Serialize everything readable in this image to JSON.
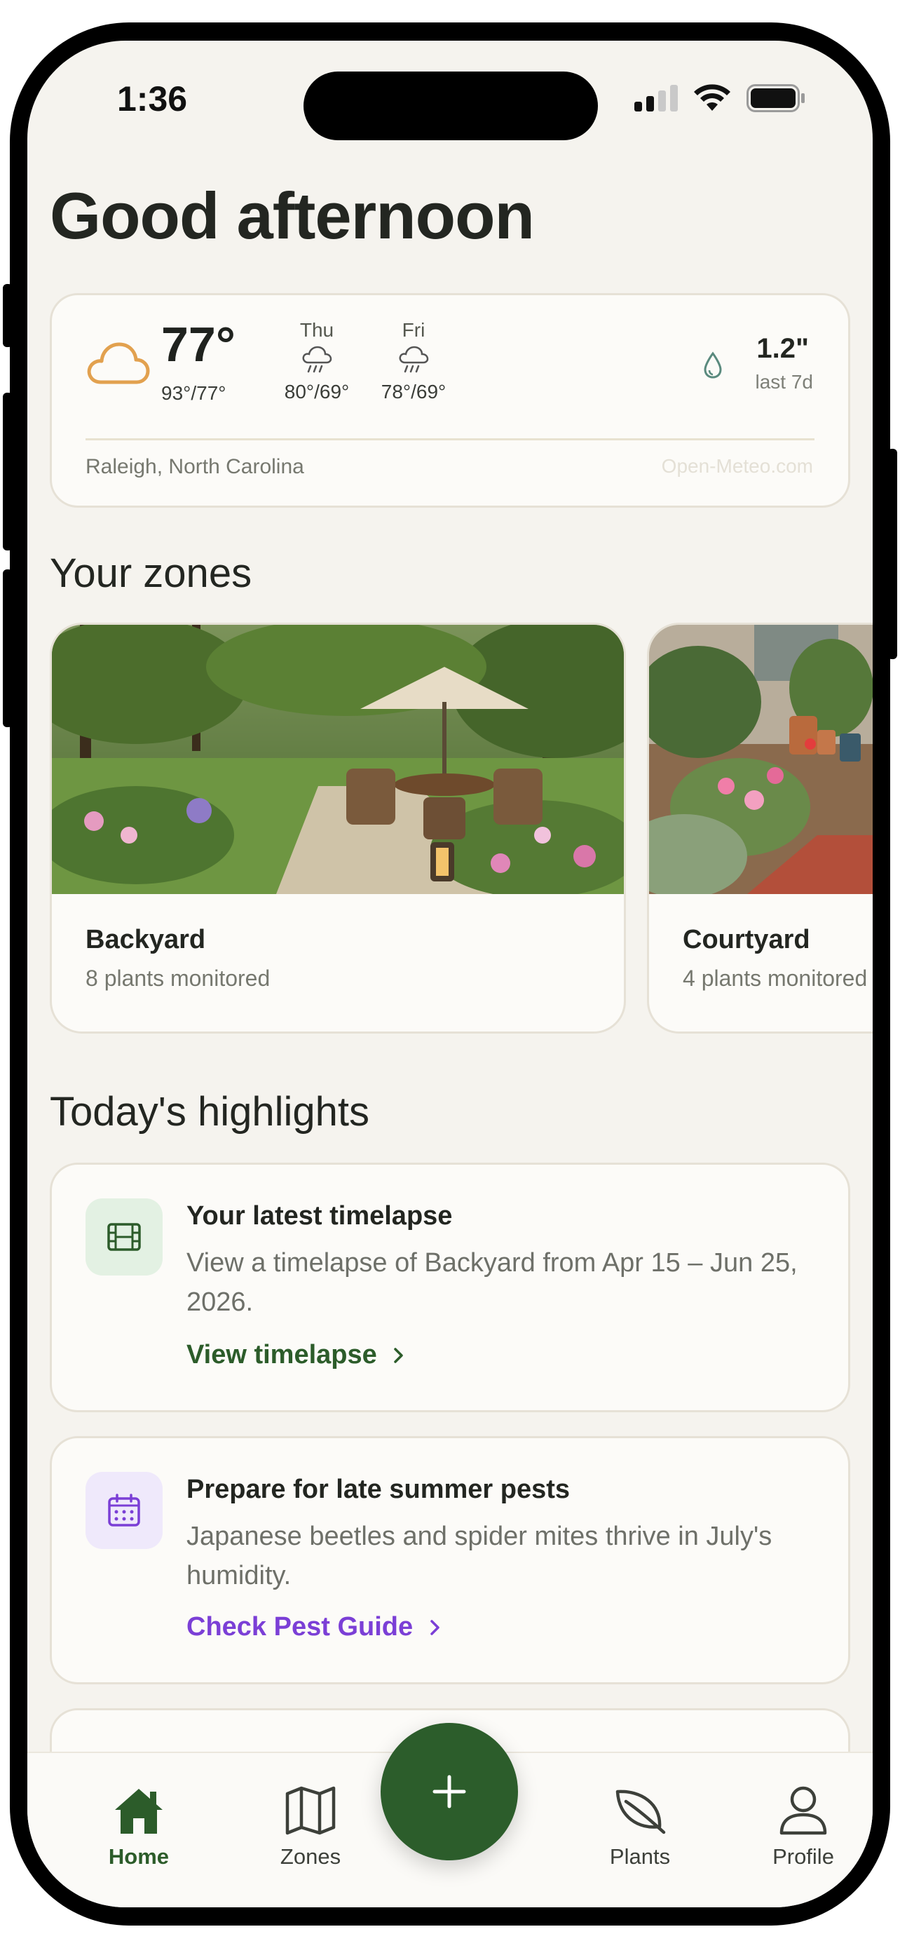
{
  "status_bar": {
    "time": "1:36"
  },
  "greeting": "Good afternoon",
  "weather": {
    "current_temp": "77°",
    "current_range": "93°/77°",
    "forecast": [
      {
        "day": "Thu",
        "range": "80°/69°",
        "icon": "rain-cloud-icon"
      },
      {
        "day": "Fri",
        "range": "78°/69°",
        "icon": "rain-cloud-icon"
      }
    ],
    "rainfall": "1.2\"",
    "rainfall_period": "last 7d",
    "location": "Raleigh, North Carolina",
    "source": "Open-Meteo.com"
  },
  "zones": {
    "title": "Your zones",
    "items": [
      {
        "name": "Backyard",
        "count": "8 plants monitored"
      },
      {
        "name": "Courtyard",
        "count": "4 plants monitored"
      }
    ]
  },
  "highlights": {
    "title": "Today's highlights",
    "items": [
      {
        "title": "Your latest timelapse",
        "body": "View a timelapse of Backyard from Apr 15 – Jun 25, 2026.",
        "link": "View timelapse",
        "icon": "film-icon",
        "accent": "#2c5c2a"
      },
      {
        "title": "Prepare for late summer pests",
        "body": "Japanese beetles and spider mites thrive in July's humidity.",
        "link": "Check Pest Guide",
        "icon": "calendar-icon",
        "accent": "#7b3fd6"
      }
    ]
  },
  "tabbar": {
    "items": [
      {
        "label": "Home",
        "icon": "home-icon",
        "active": true
      },
      {
        "label": "Zones",
        "icon": "map-icon"
      },
      {
        "label": "Plants",
        "icon": "leaf-icon"
      },
      {
        "label": "Profile",
        "icon": "person-icon"
      }
    ],
    "fab_icon": "plus-icon"
  },
  "colors": {
    "brand_green": "#2c5d2b",
    "background": "#f5f3ee",
    "purple_accent": "#7b3fd6"
  }
}
